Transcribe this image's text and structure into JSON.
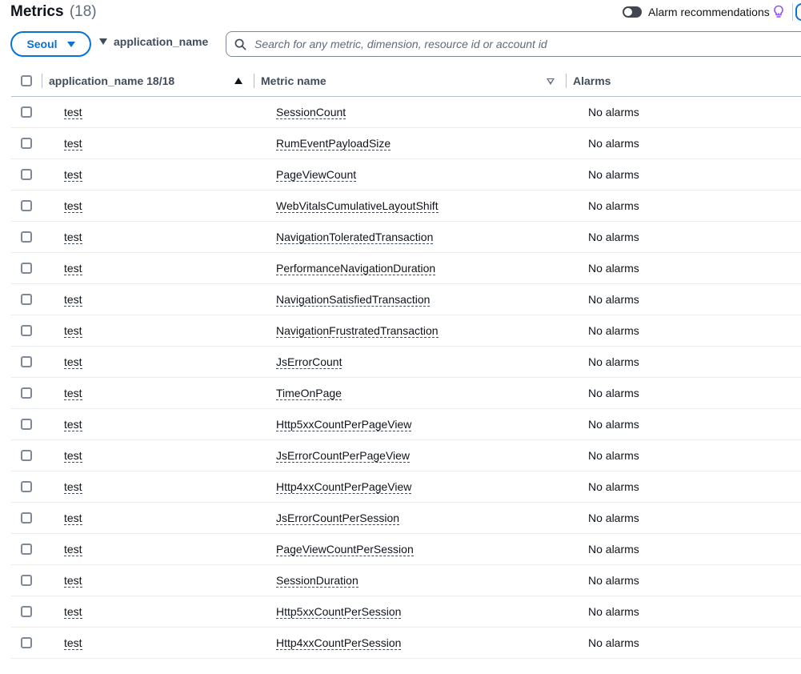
{
  "header": {
    "title": "Metrics",
    "count": "(18)",
    "alarm_recommendations_label": "Alarm recommendations"
  },
  "filters": {
    "region": "Seoul",
    "dimension": "application_name",
    "search_placeholder": "Search for any metric, dimension, resource id or account id"
  },
  "table": {
    "columns": {
      "application_name": "application_name 18/18",
      "metric_name": "Metric name",
      "alarms": "Alarms"
    },
    "rows": [
      {
        "app": "test",
        "metric": "SessionCount",
        "alarms": "No alarms"
      },
      {
        "app": "test",
        "metric": "RumEventPayloadSize",
        "alarms": "No alarms"
      },
      {
        "app": "test",
        "metric": "PageViewCount",
        "alarms": "No alarms"
      },
      {
        "app": "test",
        "metric": "WebVitalsCumulativeLayoutShift",
        "alarms": "No alarms"
      },
      {
        "app": "test",
        "metric": "NavigationToleratedTransaction",
        "alarms": "No alarms"
      },
      {
        "app": "test",
        "metric": "PerformanceNavigationDuration",
        "alarms": "No alarms"
      },
      {
        "app": "test",
        "metric": "NavigationSatisfiedTransaction",
        "alarms": "No alarms"
      },
      {
        "app": "test",
        "metric": "NavigationFrustratedTransaction",
        "alarms": "No alarms"
      },
      {
        "app": "test",
        "metric": "JsErrorCount",
        "alarms": "No alarms"
      },
      {
        "app": "test",
        "metric": "TimeOnPage",
        "alarms": "No alarms"
      },
      {
        "app": "test",
        "metric": "Http5xxCountPerPageView",
        "alarms": "No alarms"
      },
      {
        "app": "test",
        "metric": "JsErrorCountPerPageView",
        "alarms": "No alarms"
      },
      {
        "app": "test",
        "metric": "Http4xxCountPerPageView",
        "alarms": "No alarms"
      },
      {
        "app": "test",
        "metric": "JsErrorCountPerSession",
        "alarms": "No alarms"
      },
      {
        "app": "test",
        "metric": "PageViewCountPerSession",
        "alarms": "No alarms"
      },
      {
        "app": "test",
        "metric": "SessionDuration",
        "alarms": "No alarms"
      },
      {
        "app": "test",
        "metric": "Http5xxCountPerSession",
        "alarms": "No alarms"
      },
      {
        "app": "test",
        "metric": "Http4xxCountPerSession",
        "alarms": "No alarms"
      }
    ]
  },
  "colors": {
    "accent": "#0972d3",
    "bulb": "#8c4fff",
    "toggle_off": "#424650"
  },
  "icons": {
    "search": "search-icon",
    "bulb": "lightbulb-icon",
    "region_caret": "caret-down-icon",
    "sort_asc": "sort-ascending-icon",
    "sort_desc": "sort-descending-icon"
  }
}
